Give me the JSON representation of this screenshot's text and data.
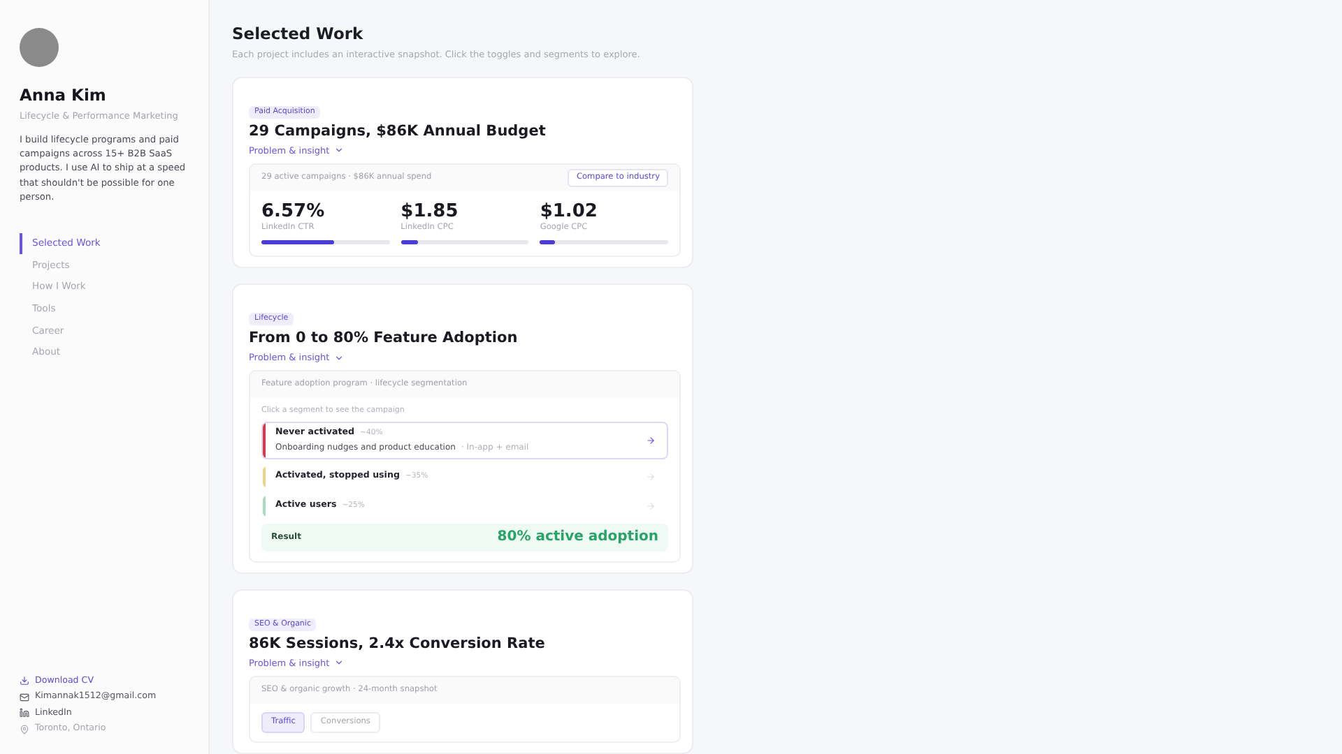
{
  "profile": {
    "name": "Anna Kim",
    "role": "Lifecycle & Performance Marketing",
    "bio": "I build lifecycle programs and paid campaigns across 15+ B2B SaaS products. I use AI to ship at a speed that shouldn't be possible for one person."
  },
  "nav": [
    {
      "label": "Selected Work",
      "selected": true
    },
    {
      "label": "Projects",
      "selected": false
    },
    {
      "label": "How I Work",
      "selected": false
    },
    {
      "label": "Tools",
      "selected": false
    },
    {
      "label": "Career",
      "selected": false
    },
    {
      "label": "About",
      "selected": false
    }
  ],
  "links": [
    {
      "kind": "download",
      "label": "Download CV"
    },
    {
      "kind": "email",
      "label": "Kimannak1512@gmail.com"
    },
    {
      "kind": "linkedin",
      "label": "LinkedIn"
    },
    {
      "kind": "location",
      "label": "Toronto, Ontario"
    }
  ],
  "heading": "Selected Work",
  "subheading": "Each project includes an interactive snapshot. Click the toggles and segments to explore.",
  "cards": [
    {
      "kind": "metrics",
      "tag": "Paid Acquisition",
      "title": "29 Campaigns, $86K Annual Budget",
      "toggle": "Problem & insight",
      "panel_title": "29 active campaigns · $86K annual spend",
      "action": "Compare to industry",
      "metrics": [
        {
          "value": "6.57%",
          "label": "LinkedIn CTR",
          "level": 0.57
        },
        {
          "value": "$1.85",
          "label": "LinkedIn CPC",
          "level": 0.13
        },
        {
          "value": "$1.02",
          "label": "Google CPC",
          "level": 0.12
        }
      ]
    },
    {
      "kind": "segments",
      "tag": "Lifecycle",
      "title": "From 0 to 80% Feature Adoption",
      "toggle": "Problem & insight",
      "panel_title": "Feature adoption program · lifecycle segmentation",
      "hint": "Click a segment to see the campaign",
      "segments": [
        {
          "name": "Never activated",
          "share": "~40%",
          "color": "#d63b4a",
          "selected": true,
          "detail": "Onboarding nudges and product education",
          "channel": "· In-app + email"
        },
        {
          "name": "Activated, stopped using",
          "share": "~35%",
          "color": "#f0d28a",
          "selected": false
        },
        {
          "name": "Active users",
          "share": "~25%",
          "color": "#a8dcc0",
          "selected": false
        }
      ],
      "result_label": "Result",
      "result_value": "80% active adoption"
    },
    {
      "kind": "tabs",
      "tag": "SEO & Organic",
      "title": "86K Sessions, 2.4x Conversion Rate",
      "toggle": "Problem & insight",
      "panel_title": "SEO & organic growth · 24-month snapshot",
      "tabs": [
        {
          "label": "Traffic",
          "selected": true
        },
        {
          "label": "Conversions",
          "selected": false
        }
      ]
    }
  ]
}
